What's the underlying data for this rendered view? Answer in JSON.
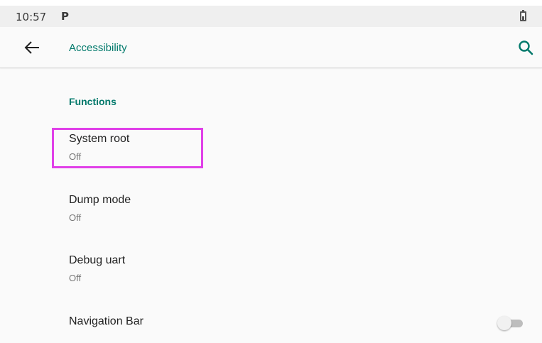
{
  "status_bar": {
    "time": "10:57",
    "notification_icon_text": "P"
  },
  "app_bar": {
    "title": "Accessibility",
    "back_icon": "arrow-left-icon",
    "search_icon": "search-icon"
  },
  "section": {
    "header": "Functions"
  },
  "items": [
    {
      "title": "System root",
      "summary": "Off"
    },
    {
      "title": "Dump mode",
      "summary": "Off"
    },
    {
      "title": "Debug uart",
      "summary": "Off"
    },
    {
      "title": "Navigation Bar",
      "toggle": "off"
    }
  ],
  "colors": {
    "accent": "#00796b",
    "highlight": "#e040e8",
    "background": "#fafafa"
  }
}
